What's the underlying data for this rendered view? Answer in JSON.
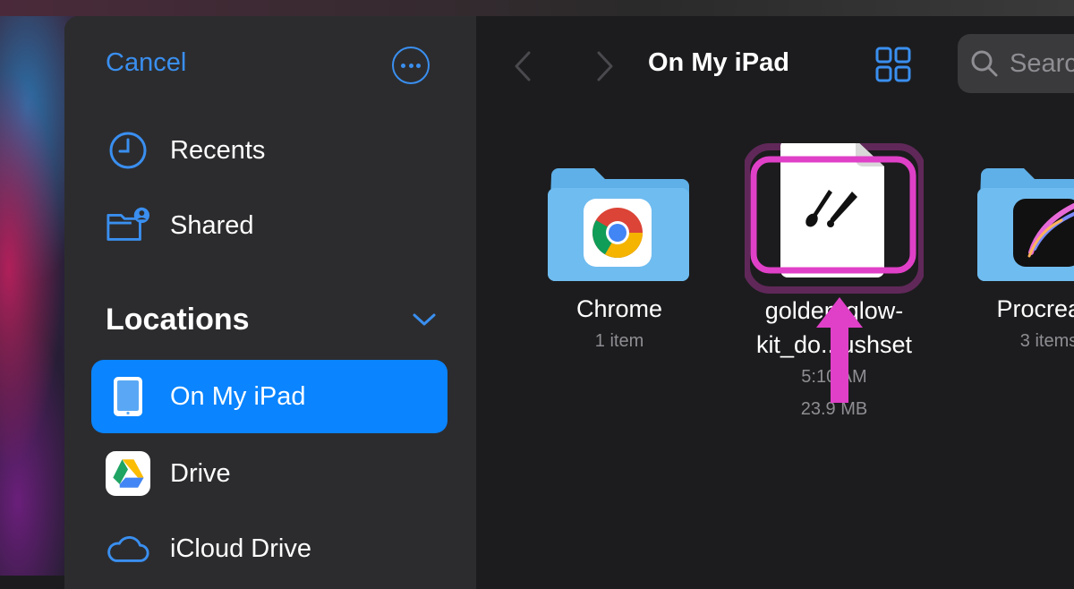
{
  "sidebar": {
    "cancel_label": "Cancel",
    "items": [
      {
        "label": "Recents",
        "icon": "clock-icon"
      },
      {
        "label": "Shared",
        "icon": "shared-folder-icon"
      }
    ],
    "locations_title": "Locations",
    "locations": [
      {
        "label": "On My iPad",
        "icon": "ipad-icon",
        "selected": true
      },
      {
        "label": "Drive",
        "icon": "google-drive-icon"
      },
      {
        "label": "iCloud Drive",
        "icon": "cloud-icon"
      }
    ]
  },
  "toolbar": {
    "title": "On My iPad",
    "search_placeholder": "Search"
  },
  "files": [
    {
      "name": "Chrome",
      "meta": "1 item"
    },
    {
      "name_line1": "golden-glow-",
      "name_line2": "kit_do...ushset",
      "time": "5:10 AM",
      "size": "23.9 MB"
    },
    {
      "name": "Procreate",
      "meta": "3 items"
    }
  ],
  "colors": {
    "accent": "#0a84ff",
    "highlight": "#e040c8",
    "folder": "#5fb0e8"
  }
}
